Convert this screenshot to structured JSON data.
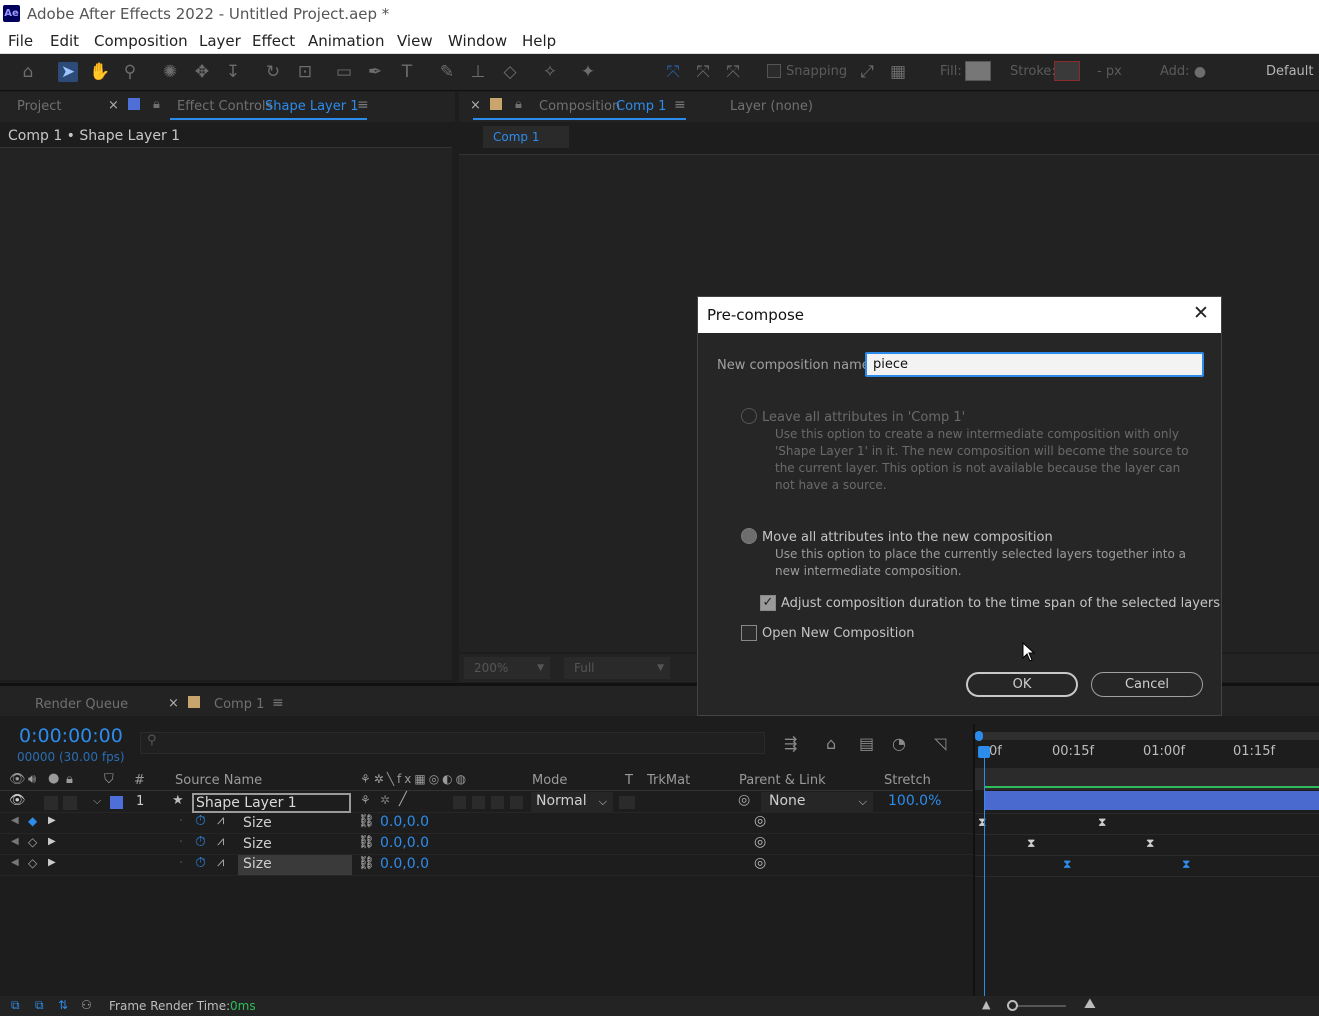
{
  "window": {
    "app_badge": "Ae",
    "title": "Adobe After Effects 2022 - Untitled Project.aep *"
  },
  "menu": [
    "File",
    "Edit",
    "Composition",
    "Layer",
    "Effect",
    "Animation",
    "View",
    "Window",
    "Help"
  ],
  "toolbar": {
    "snapping_label": "Snapping",
    "fill_label": "Fill:",
    "stroke_label": "Stroke:",
    "stroke_unit": "- px",
    "add_label": "Add:",
    "workspace": "Default",
    "accent_color": "#2d8ceb"
  },
  "left_panel": {
    "tab_project": "Project",
    "tab_effect_controls": "Effect Controls",
    "effect_controls_target": "Shape Layer 1",
    "breadcrumb": "Comp 1 • Shape Layer 1"
  },
  "comp_panel": {
    "tab_composition": "Composition",
    "composition_name": "Comp 1",
    "tab_layer": "Layer (none)",
    "subtab": "Comp 1",
    "zoom": "200%",
    "resolution": "Full"
  },
  "dialog": {
    "title": "Pre-compose",
    "name_label": "New composition name:",
    "name_value": "piece",
    "option1_label": "Leave all attributes in 'Comp 1'",
    "option1_desc": "Use this option to create a new intermediate composition with only 'Shape Layer 1' in it. The new composition will become the source to the current layer. This option is not available because the layer can not have a source.",
    "option2_label": "Move all attributes into the new composition",
    "option2_desc": "Use this option to place the currently selected layers together into a new intermediate composition.",
    "adjust_label": "Adjust composition duration to the time span of the selected layers",
    "adjust_checked": true,
    "open_new_label": "Open New Composition",
    "open_new_checked": false,
    "ok_label": "OK",
    "cancel_label": "Cancel"
  },
  "timeline": {
    "tab_render_queue": "Render Queue",
    "tab_comp": "Comp 1",
    "timecode": "0:00:00:00",
    "frames_fps": "00000 (30.00 fps)",
    "columns": {
      "hash": "#",
      "source_name": "Source Name",
      "mode": "Mode",
      "t": "T",
      "trkmat": "TrkMat",
      "parent_link": "Parent & Link",
      "stretch": "Stretch"
    },
    "ruler": [
      "0f",
      "00:15f",
      "01:00f",
      "01:15f"
    ],
    "layer": {
      "index": "1",
      "name": "Shape Layer 1",
      "mode": "Normal",
      "parent": "None",
      "stretch": "100.0%"
    },
    "properties": [
      {
        "name": "Size",
        "value": "0.0,0.0"
      },
      {
        "name": "Size",
        "value": "0.0,0.0"
      },
      {
        "name": "Size",
        "value": "0.0,0.0"
      }
    ],
    "status_label": "Frame Render Time:",
    "status_value": "0ms"
  }
}
